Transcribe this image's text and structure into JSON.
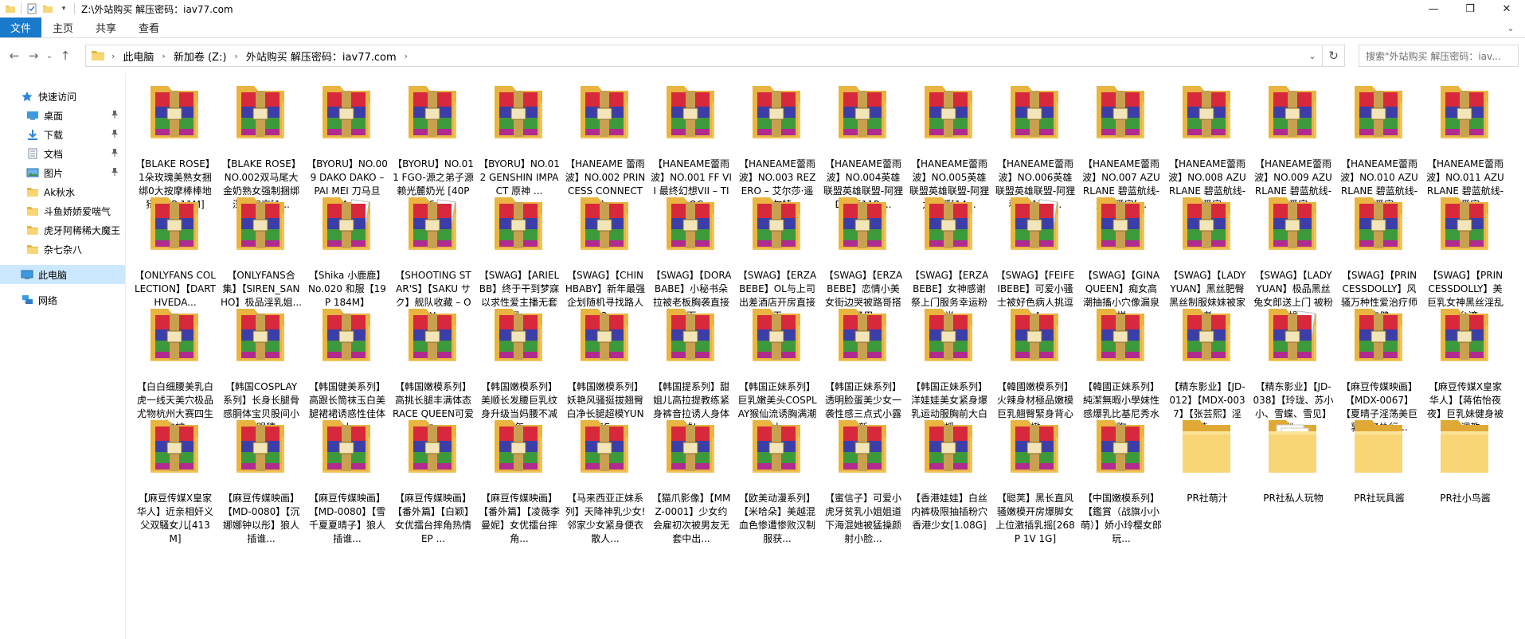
{
  "window": {
    "title": "Z:\\外站购买 解压密码：iav77.com",
    "controls": {
      "minimize": "—",
      "maximize": "❐",
      "close": "✕"
    }
  },
  "ribbon": {
    "tabs": [
      "文件",
      "主页",
      "共享",
      "查看"
    ],
    "expand_icon": "⌄"
  },
  "nav": {
    "back": "←",
    "forward": "→",
    "recent": "⌄",
    "up": "↑",
    "breadcrumbs": [
      "此电脑",
      "新加卷 (Z:)",
      "外站购买 解压密码：iav77.com"
    ],
    "crumb_sep": "›",
    "address_dropdown": "⌄",
    "refresh": "↻",
    "search_placeholder": "搜索\"外站购买 解压密码：iav..."
  },
  "sidebar": {
    "quick_access": "快速访问",
    "items": [
      {
        "label": "桌面",
        "icon": "desktop-icon",
        "pinned": true
      },
      {
        "label": "下载",
        "icon": "download-icon",
        "pinned": true
      },
      {
        "label": "文档",
        "icon": "documents-icon",
        "pinned": true
      },
      {
        "label": "图片",
        "icon": "pictures-icon",
        "pinned": true
      },
      {
        "label": "Ak秋水",
        "icon": "folder-icon",
        "pinned": false
      },
      {
        "label": "斗鱼娇娇爱喘气",
        "icon": "folder-icon",
        "pinned": false
      },
      {
        "label": "虎牙阿稀稀大魔王",
        "icon": "folder-icon",
        "pinned": false
      },
      {
        "label": "杂七杂八",
        "icon": "folder-icon",
        "pinned": false
      }
    ],
    "this_pc": "此电脑",
    "network": "网络",
    "pin_glyph": "📌"
  },
  "files": [
    {
      "name": "【BLAKE ROSE】1朵玫瑰美熟女捆绑0大按摩棒棒地狱[15P 11M]",
      "type": "archive"
    },
    {
      "name": "【BLAKE ROSE】NO.002双马尾大金奶熟女强制捆绑深喉口交[1...",
      "type": "archive"
    },
    {
      "name": "【BYORU】NO.009 DAKO DAKO – PAI MEI 刀马旦 [4...",
      "type": "archive"
    },
    {
      "name": "【BYORU】NO.011 FGO-源之弟子源赖光麓奶光 [40P 16...",
      "type": "archive"
    },
    {
      "name": "【BYORU】NO.012 GENSHIN IMPACT 原神 ...",
      "type": "archive"
    },
    {
      "name": "【HANEAME 蕾雨波】NO.002 PRINCESS CONNECT 公...",
      "type": "archive"
    },
    {
      "name": "【HANEAME蕾雨波】NO.001 FF VII 最终幻想VII – TIFA LOC...",
      "type": "archive"
    },
    {
      "name": "【HANEAME蕾雨波】NO.003 REZERO – 艾尔莎·遥兰蒂尔特...",
      "type": "archive"
    },
    {
      "name": "【HANEAME蕾雨波】NO.004英雄联盟英雄联盟-阿狸DVA [11P ...",
      "type": "archive"
    },
    {
      "name": "【HANEAME蕾雨波】NO.005英雄联盟英雄联盟-阿狸九尾狐[14...",
      "type": "archive"
    },
    {
      "name": "【HANEAME蕾雨波】NO.006英雄联盟英雄联盟-阿狸秋天[17P ...",
      "type": "archive"
    },
    {
      "name": "【HANEAME蕾雨波】NO.007 AZURLANE 碧蓝航线-爱宕爱宕[...",
      "type": "archive"
    },
    {
      "name": "【HANEAME蕾雨波】NO.008 AZURLANE 碧蓝航线-爱宕爱宕...",
      "type": "archive"
    },
    {
      "name": "【HANEAME蕾雨波】NO.009 AZURLANE 碧蓝航线-爱宕爱宕...",
      "type": "archive"
    },
    {
      "name": "【HANEAME蕾雨波】NO.010 AZURLANE 碧蓝航线-爱宕爱宕...",
      "type": "archive"
    },
    {
      "name": "【HANEAME蕾雨波】NO.011 AZURLANE 碧蓝航线-爱宕爱宕...",
      "type": "archive"
    },
    {
      "name": "【ONLYFANS COLLECTION】【DARTHVEDA...",
      "type": "archive"
    },
    {
      "name": "【ONLYFANS合集】【SIREN_SANHO】极品淫乳姐...",
      "type": "archive"
    },
    {
      "name": "【Shika 小鹿鹿】No.020 和服【19P 184M】",
      "type": "archive-open"
    },
    {
      "name": "【SHOOTING STAR'S】【SAKU サク】舰队收藏 – ORY...",
      "type": "archive-open"
    },
    {
      "name": "【SWAG】【ARIELBB】终于干到梦寐以求性爱主播无套深...",
      "type": "archive"
    },
    {
      "name": "【SWAG】【CHINHBABY】新年最强企划随机寻找路人U2...",
      "type": "archive"
    },
    {
      "name": "【SWAG】【DORABABE】小秘书朵拉被老板胸袭直接脱下...",
      "type": "archive"
    },
    {
      "name": "【SWAG】【ERZABEBE】OL与上司出差酒店开房直接开干...",
      "type": "archive"
    },
    {
      "name": "【SWAG】【ERZABEBE】恋情小美女街边哭被路哥搭讪了用...",
      "type": "archive"
    },
    {
      "name": "【SWAG】【ERZABEBE】女神感谢祭上门服务幸运粉丝光...",
      "type": "archive"
    },
    {
      "name": "【SWAG】【FEIFEIBEBE】可爱小骚士被好色病人挑逗 [1.4...",
      "type": "archive-open"
    },
    {
      "name": "【SWAG】【GINAQUEEN】痴女高潮抽搐小穴像漏泉一样...",
      "type": "archive"
    },
    {
      "name": "【SWAG】【LADYYUAN】黑丝肥臀黑丝制服妹妹被家庭老...",
      "type": "archive"
    },
    {
      "name": "【SWAG】【LADYYUAN】极品黑丝兔女郎送上门 被粉丝操...",
      "type": "archive"
    },
    {
      "name": "【SWAG】【PRINCESSDOLLY】风骚万种性爱治疗师亲自健...",
      "type": "archive"
    },
    {
      "name": "【SWAG】【PRINCESSDOLLY】美巨乳女神黑丝淫乱多P台湾...",
      "type": "archive"
    },
    {
      "name": "【白白细腰美乳白虎一线天美穴极品尤物杭州大赛四生白白被...",
      "type": "archive"
    },
    {
      "name": "【韩国COSPLAY系列】长身长腿骨感胴体宝贝股间小裤裤眼睛...",
      "type": "archive"
    },
    {
      "name": "【韩国健美系列】高跟长筒袜玉白美腿裙裙诱惑性佳体毕小...",
      "type": "archive"
    },
    {
      "name": "【韩国嫩模系列】高挑长腿丰满体态RACE QUEEN可爱女...",
      "type": "archive"
    },
    {
      "name": "【韩国嫩模系列】美顺长发腰巨乳纹身升级当妈腰不减当年...",
      "type": "archive"
    },
    {
      "name": "【韩国嫩模系列】妖艳风骚挺拔翘臀白净长腿超模YUNASE...",
      "type": "archive"
    },
    {
      "name": "【韩国提系列】甜姐儿高拉提教练紧身裤音拉诱人身体曲线! ...",
      "type": "archive"
    },
    {
      "name": "【韩国正妹系列】巨乳嫩美头COSPLAY猴仙流诱胸满潮作上...",
      "type": "archive"
    },
    {
      "name": "【韩国正妹系列】透明脸蛋美少女一袭性感三点式小露最新...",
      "type": "archive"
    },
    {
      "name": "【韩国正妹系列】洋娃娃美女紧身爆乳运动服胸前大白奶摇...",
      "type": "archive"
    },
    {
      "name": "【韓國嫩模系列】火辣身材極品嫩模巨乳翹臀緊身背心白嫩...",
      "type": "archive"
    },
    {
      "name": "【韓國正妹系列】純潔無暇小學妹性感爆乳比基尼秀水嫩胸...",
      "type": "archive"
    },
    {
      "name": "【精东影业】【JD-012】【MDX-0037】【张芸熙】淫荡...",
      "type": "archive"
    },
    {
      "name": "【精东影业】【JD-038】【玲珑、苏小小、雪蝶、雪见】剧...",
      "type": "archive-open"
    },
    {
      "name": "【麻豆传媒映画】【MDX-0067】【夏晴子淫荡美巨乳特务执行...",
      "type": "archive"
    },
    {
      "name": "【麻豆传媒X皇家华人】【蒋佑怡夜夜】巨乳妹健身被猛男调教...",
      "type": "archive"
    },
    {
      "name": "【麻豆传媒X皇家华人】近亲相奸义父双騷女儿[413M]",
      "type": "archive"
    },
    {
      "name": "【麻豆传媒映画】【MD-0080】【沉娜娜钟以彤】狼人插谁...",
      "type": "archive"
    },
    {
      "name": "【麻豆传媒映画】【MD-0080】【雪千夏夏晴子】狼人插谁...",
      "type": "archive"
    },
    {
      "name": "【麻豆传媒映画】【番外篇】【白颖】女优擂台摔角热情EP ...",
      "type": "archive"
    },
    {
      "name": "【麻豆传媒映画】【番外篇】【凌薇李曼妮】女优擂台摔角...",
      "type": "archive"
    },
    {
      "name": "【马来西亚正妹系列】天降神乳少女! 邻家少女紧身便衣散人...",
      "type": "archive"
    },
    {
      "name": "【猫爪影像】【MMZ-0001】少女约会雇初次被男友无套中出...",
      "type": "archive"
    },
    {
      "name": "【欧美动漫系列】【米哈朵】美越混血色惨遭惨败汉制服获...",
      "type": "archive"
    },
    {
      "name": "【蜜信子】可爱小虎牙贫乳小姐姐道下海混她被猛操颜射小脸...",
      "type": "archive"
    },
    {
      "name": "【香港娃娃】白丝内裤极限抽插粉穴香港少女[1.08G]",
      "type": "archive"
    },
    {
      "name": "【聪荚】黑长直风骚嫩模开房爆脚女上位激插乳摇[268P 1V 1G]",
      "type": "archive"
    },
    {
      "name": "【中国嫩模系列】【鑑賞（战旗小小萌）】娇小玲樱女郎玩...",
      "type": "archive"
    },
    {
      "name": "PR社萌汁",
      "type": "folder"
    },
    {
      "name": "PR社私人玩物",
      "type": "folder-docs"
    },
    {
      "name": "PR社玩具酱",
      "type": "folder"
    },
    {
      "name": "PR社小鸟酱",
      "type": "folder"
    }
  ]
}
